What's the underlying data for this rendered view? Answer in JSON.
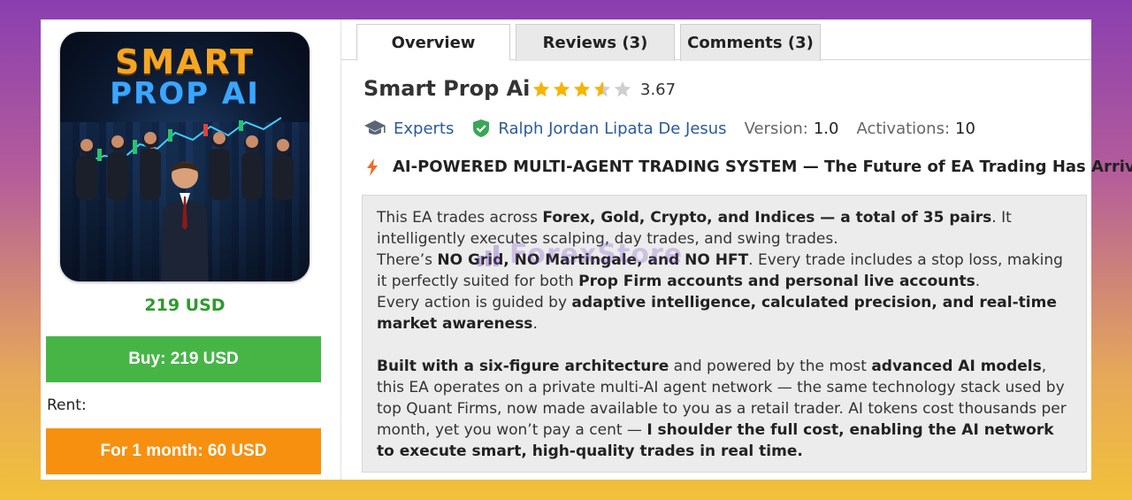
{
  "product": {
    "image_title_1": "SMART",
    "image_title_2": "PROP AI",
    "price": "219 USD",
    "buy_label": "Buy: 219 USD",
    "rent_label": "Rent:",
    "rent_option": "For 1 month: 60 USD"
  },
  "tabs": [
    {
      "label": "Overview",
      "active": true
    },
    {
      "label": "Reviews (3)",
      "active": false
    },
    {
      "label": "Comments (3)",
      "active": false
    }
  ],
  "header": {
    "title": "Smart Prop Ai",
    "rating": 3.67,
    "rating_text": "3.67",
    "category": "Experts",
    "author": "Ralph Jordan Lipata De Jesus",
    "version_label": "Version:",
    "version": "1.0",
    "activations_label": "Activations:",
    "activations": "10"
  },
  "headline": "AI-POWERED MULTI-AGENT TRADING SYSTEM — The Future of EA Trading Has Arrived",
  "description": {
    "p1_a": "This EA trades across ",
    "p1_b": "Forex, Gold, Crypto, and Indices — a total of 35 pairs",
    "p1_c": ". It intelligently executes scalping, day trades, and swing trades.",
    "p2_a": "There’s ",
    "p2_b": "NO Grid, NO Martingale, and NO HFT",
    "p2_c": ". Every trade includes a stop loss, making it perfectly suited for both ",
    "p2_d": "Prop Firm accounts and personal live accounts",
    "p2_e": ".",
    "p3_a": "Every action is guided by ",
    "p3_b": "adaptive intelligence, calculated precision, and real-time market awareness",
    "p3_c": ".",
    "p4_a": "Built with a six-figure architecture",
    "p4_b": " and powered by the most ",
    "p4_c": "advanced AI models",
    "p4_d": ", this EA operates on a private multi-AI agent network — the same technology stack used by top Quant Firms, now made available to you as a retail trader. AI tokens cost thousands per month, yet you won’t pay a cent — ",
    "p4_e": "I shoulder the full cost, enabling the AI network to execute smart, high-quality trades in real time."
  },
  "watermark": "ForexStore",
  "colors": {
    "price_green": "#2f9a2f",
    "buy_button": "#46b546",
    "rent_button": "#f7900f",
    "link": "#2b5a9c",
    "star": "#f5b400"
  },
  "icons": {
    "category": "graduation-cap-icon",
    "author": "verified-shield-icon",
    "headline": "lightning-bolt-icon"
  }
}
